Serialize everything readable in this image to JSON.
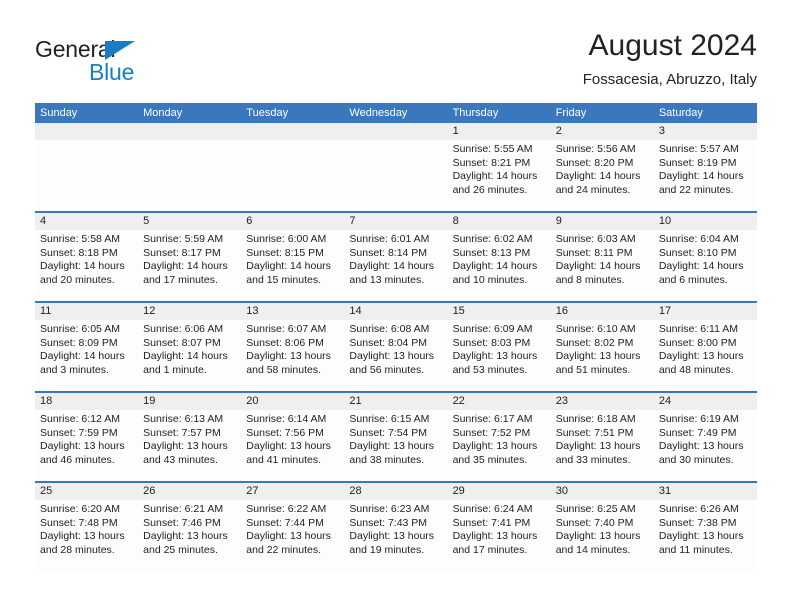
{
  "brand": {
    "line1": "General",
    "line2": "Blue",
    "triangle_color": "#1a7dc4"
  },
  "header": {
    "title": "August 2024",
    "subtitle": "Fossacesia, Abruzzo, Italy"
  },
  "theme": {
    "header_blue": "#3a77bd",
    "row_divider_blue": "#3a77bd",
    "daynum_band": "#efefef",
    "text": "#222222"
  },
  "weekdays": [
    "Sunday",
    "Monday",
    "Tuesday",
    "Wednesday",
    "Thursday",
    "Friday",
    "Saturday"
  ],
  "weeks": [
    {
      "days": [
        {
          "num": "",
          "lines": [
            "",
            "",
            "",
            ""
          ]
        },
        {
          "num": "",
          "lines": [
            "",
            "",
            "",
            ""
          ]
        },
        {
          "num": "",
          "lines": [
            "",
            "",
            "",
            ""
          ]
        },
        {
          "num": "",
          "lines": [
            "",
            "",
            "",
            ""
          ]
        },
        {
          "num": "1",
          "lines": [
            "Sunrise: 5:55 AM",
            "Sunset: 8:21 PM",
            "Daylight: 14 hours",
            "and 26 minutes."
          ]
        },
        {
          "num": "2",
          "lines": [
            "Sunrise: 5:56 AM",
            "Sunset: 8:20 PM",
            "Daylight: 14 hours",
            "and 24 minutes."
          ]
        },
        {
          "num": "3",
          "lines": [
            "Sunrise: 5:57 AM",
            "Sunset: 8:19 PM",
            "Daylight: 14 hours",
            "and 22 minutes."
          ]
        }
      ]
    },
    {
      "days": [
        {
          "num": "4",
          "lines": [
            "Sunrise: 5:58 AM",
            "Sunset: 8:18 PM",
            "Daylight: 14 hours",
            "and 20 minutes."
          ]
        },
        {
          "num": "5",
          "lines": [
            "Sunrise: 5:59 AM",
            "Sunset: 8:17 PM",
            "Daylight: 14 hours",
            "and 17 minutes."
          ]
        },
        {
          "num": "6",
          "lines": [
            "Sunrise: 6:00 AM",
            "Sunset: 8:15 PM",
            "Daylight: 14 hours",
            "and 15 minutes."
          ]
        },
        {
          "num": "7",
          "lines": [
            "Sunrise: 6:01 AM",
            "Sunset: 8:14 PM",
            "Daylight: 14 hours",
            "and 13 minutes."
          ]
        },
        {
          "num": "8",
          "lines": [
            "Sunrise: 6:02 AM",
            "Sunset: 8:13 PM",
            "Daylight: 14 hours",
            "and 10 minutes."
          ]
        },
        {
          "num": "9",
          "lines": [
            "Sunrise: 6:03 AM",
            "Sunset: 8:11 PM",
            "Daylight: 14 hours",
            "and 8 minutes."
          ]
        },
        {
          "num": "10",
          "lines": [
            "Sunrise: 6:04 AM",
            "Sunset: 8:10 PM",
            "Daylight: 14 hours",
            "and 6 minutes."
          ]
        }
      ]
    },
    {
      "days": [
        {
          "num": "11",
          "lines": [
            "Sunrise: 6:05 AM",
            "Sunset: 8:09 PM",
            "Daylight: 14 hours",
            "and 3 minutes."
          ]
        },
        {
          "num": "12",
          "lines": [
            "Sunrise: 6:06 AM",
            "Sunset: 8:07 PM",
            "Daylight: 14 hours",
            "and 1 minute."
          ]
        },
        {
          "num": "13",
          "lines": [
            "Sunrise: 6:07 AM",
            "Sunset: 8:06 PM",
            "Daylight: 13 hours",
            "and 58 minutes."
          ]
        },
        {
          "num": "14",
          "lines": [
            "Sunrise: 6:08 AM",
            "Sunset: 8:04 PM",
            "Daylight: 13 hours",
            "and 56 minutes."
          ]
        },
        {
          "num": "15",
          "lines": [
            "Sunrise: 6:09 AM",
            "Sunset: 8:03 PM",
            "Daylight: 13 hours",
            "and 53 minutes."
          ]
        },
        {
          "num": "16",
          "lines": [
            "Sunrise: 6:10 AM",
            "Sunset: 8:02 PM",
            "Daylight: 13 hours",
            "and 51 minutes."
          ]
        },
        {
          "num": "17",
          "lines": [
            "Sunrise: 6:11 AM",
            "Sunset: 8:00 PM",
            "Daylight: 13 hours",
            "and 48 minutes."
          ]
        }
      ]
    },
    {
      "days": [
        {
          "num": "18",
          "lines": [
            "Sunrise: 6:12 AM",
            "Sunset: 7:59 PM",
            "Daylight: 13 hours",
            "and 46 minutes."
          ]
        },
        {
          "num": "19",
          "lines": [
            "Sunrise: 6:13 AM",
            "Sunset: 7:57 PM",
            "Daylight: 13 hours",
            "and 43 minutes."
          ]
        },
        {
          "num": "20",
          "lines": [
            "Sunrise: 6:14 AM",
            "Sunset: 7:56 PM",
            "Daylight: 13 hours",
            "and 41 minutes."
          ]
        },
        {
          "num": "21",
          "lines": [
            "Sunrise: 6:15 AM",
            "Sunset: 7:54 PM",
            "Daylight: 13 hours",
            "and 38 minutes."
          ]
        },
        {
          "num": "22",
          "lines": [
            "Sunrise: 6:17 AM",
            "Sunset: 7:52 PM",
            "Daylight: 13 hours",
            "and 35 minutes."
          ]
        },
        {
          "num": "23",
          "lines": [
            "Sunrise: 6:18 AM",
            "Sunset: 7:51 PM",
            "Daylight: 13 hours",
            "and 33 minutes."
          ]
        },
        {
          "num": "24",
          "lines": [
            "Sunrise: 6:19 AM",
            "Sunset: 7:49 PM",
            "Daylight: 13 hours",
            "and 30 minutes."
          ]
        }
      ]
    },
    {
      "days": [
        {
          "num": "25",
          "lines": [
            "Sunrise: 6:20 AM",
            "Sunset: 7:48 PM",
            "Daylight: 13 hours",
            "and 28 minutes."
          ]
        },
        {
          "num": "26",
          "lines": [
            "Sunrise: 6:21 AM",
            "Sunset: 7:46 PM",
            "Daylight: 13 hours",
            "and 25 minutes."
          ]
        },
        {
          "num": "27",
          "lines": [
            "Sunrise: 6:22 AM",
            "Sunset: 7:44 PM",
            "Daylight: 13 hours",
            "and 22 minutes."
          ]
        },
        {
          "num": "28",
          "lines": [
            "Sunrise: 6:23 AM",
            "Sunset: 7:43 PM",
            "Daylight: 13 hours",
            "and 19 minutes."
          ]
        },
        {
          "num": "29",
          "lines": [
            "Sunrise: 6:24 AM",
            "Sunset: 7:41 PM",
            "Daylight: 13 hours",
            "and 17 minutes."
          ]
        },
        {
          "num": "30",
          "lines": [
            "Sunrise: 6:25 AM",
            "Sunset: 7:40 PM",
            "Daylight: 13 hours",
            "and 14 minutes."
          ]
        },
        {
          "num": "31",
          "lines": [
            "Sunrise: 6:26 AM",
            "Sunset: 7:38 PM",
            "Daylight: 13 hours",
            "and 11 minutes."
          ]
        }
      ]
    }
  ]
}
